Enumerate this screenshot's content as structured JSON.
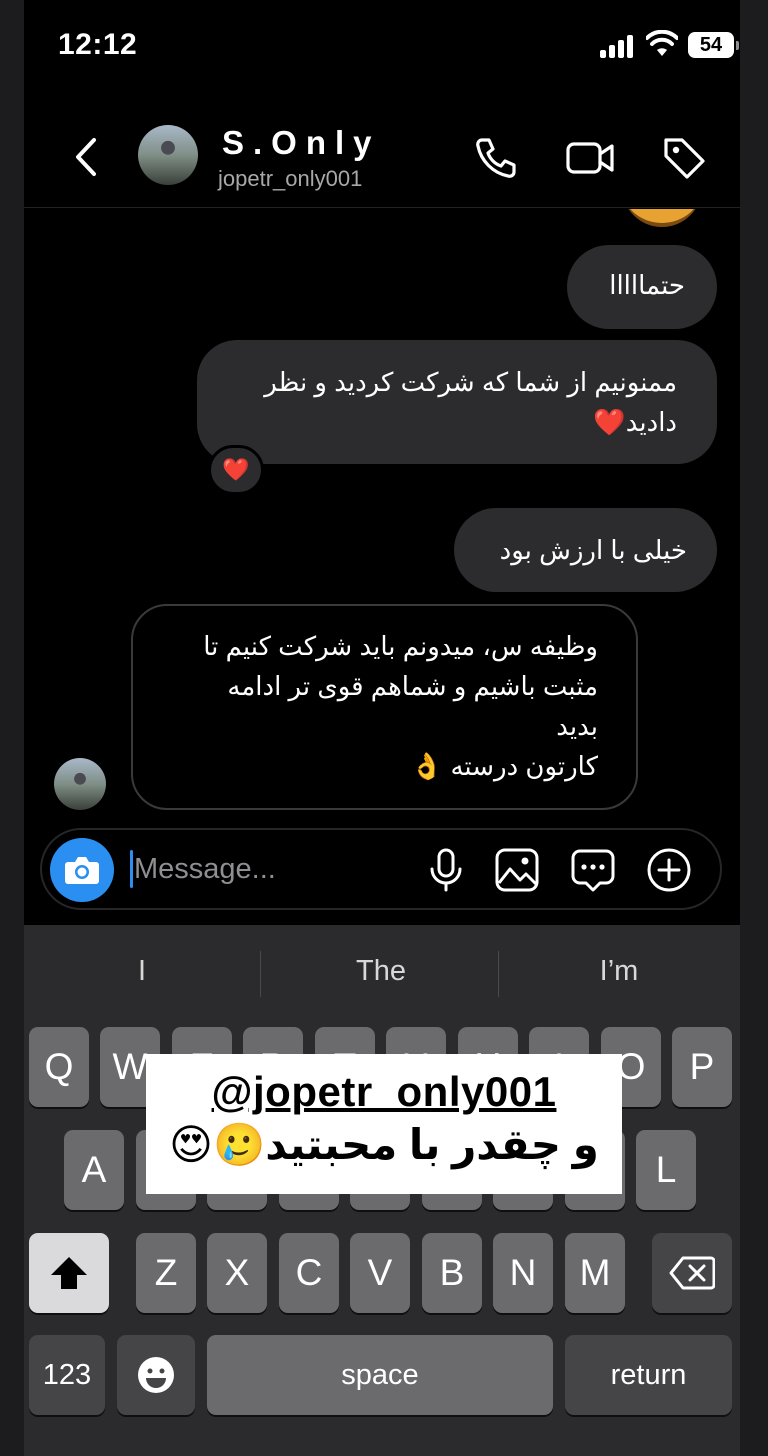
{
  "status_bar": {
    "time": "12:12",
    "battery": "54"
  },
  "header": {
    "title": "S.Only",
    "username": "jopetr_only001",
    "icons": [
      "back-chevron-icon",
      "phone-icon",
      "video-icon",
      "tag-icon"
    ]
  },
  "messages": [
    {
      "side": "outgoing",
      "text": "حتمااااا"
    },
    {
      "side": "outgoing",
      "text": "ممنونیم از شما که شرکت کردید و نظر دادید❤️",
      "reaction": "❤️"
    },
    {
      "side": "outgoing",
      "text": "خیلی با ارزش بود"
    },
    {
      "side": "incoming",
      "lines": [
        "وظیفه س، میدونم باید شرکت کنیم تا",
        "مثبت باشیم و شماهم قوی تر ادامه",
        "بدید",
        "کارتون درسته 👌"
      ]
    }
  ],
  "composer": {
    "placeholder": "Message...",
    "icons": [
      "camera-icon",
      "microphone-icon",
      "gallery-icon",
      "sticker-chat-icon",
      "plus-icon"
    ]
  },
  "keyboard": {
    "suggestions": [
      "I",
      "The",
      "I’m"
    ],
    "row1": [
      "Q",
      "W",
      "E",
      "R",
      "T",
      "Y",
      "U",
      "I",
      "O",
      "P"
    ],
    "row2": [
      "A",
      "S",
      "D",
      "F",
      "G",
      "H",
      "J",
      "K",
      "L"
    ],
    "row3": [
      "Z",
      "X",
      "C",
      "V",
      "B",
      "N",
      "M"
    ],
    "numbers_key": "123",
    "space_key": "space",
    "return_key": "return"
  },
  "overlay": {
    "handle": "@jopetr_only001",
    "caption": "و چقدر با محبتید🥲😍"
  }
}
